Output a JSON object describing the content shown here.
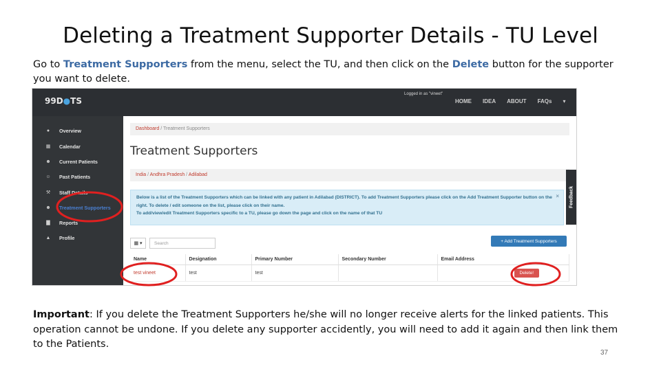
{
  "slide": {
    "title": "Deleting a Treatment Supporter Details - TU Level",
    "intro": {
      "part1": "Go to ",
      "link1": "Treatment Supporters",
      "part2": " from the menu, select the TU, and then click on the ",
      "link2": "Delete",
      "part3": " button for the supporter you want to delete."
    },
    "important_label": "Important",
    "important_text": ": If you delete the Treatment Supporters he/she will no longer receive alerts for the linked patients. This operation cannot be undone. If you delete any supporter accidently, you will need to add it again and then link them to the Patients.",
    "page_number": "37"
  },
  "app": {
    "logo_prefix": "99D",
    "logo_suffix": "TS",
    "logged_in": "Logged in as \"vineet\"",
    "topnav": [
      "HOME",
      "IDEA",
      "ABOUT",
      "FAQs",
      "▾"
    ],
    "sidebar": [
      {
        "label": "Overview",
        "icon": "●"
      },
      {
        "label": "Calendar",
        "icon": "▦"
      },
      {
        "label": "Current Patients",
        "icon": "☻"
      },
      {
        "label": "Past Patients",
        "icon": "☺"
      },
      {
        "label": "Staff Details",
        "icon": "⚒"
      },
      {
        "label": "Treatment Supporters",
        "icon": "☻"
      },
      {
        "label": "Reports",
        "icon": "▇"
      },
      {
        "label": "Profile",
        "icon": "▲"
      }
    ],
    "breadcrumb1": {
      "dashboard": "Dashboard",
      "sep": " / ",
      "current": "Treatment Supporters"
    },
    "page_heading": "Treatment Supporters",
    "breadcrumb2": {
      "l1": "India",
      "l2": "Andhra Pradesh",
      "l3": "Adilabad",
      "sep": " / "
    },
    "info_text": "Below is a list of the Treatment Supporters which can be linked with any patient in Adilabad (DISTRICT). To add Treatment Supporters please click on the Add Treatment Supporter button on the right. To delete / edit someone on the list, please click on their name.",
    "info_text2": "To add/view/edit Treatment Supporters specific to a TU, please go down the page and click on the name of that TU",
    "close_symbol": "×",
    "feedback_label": "Feedback",
    "toolbar_icon": "▦ ▾",
    "search_placeholder": "Search",
    "add_button": "+ Add Treatment Supporters",
    "table": {
      "headers": [
        "Name",
        "Designation",
        "Primary Number",
        "Secondary Number",
        "Email Address"
      ],
      "rows": [
        {
          "name": "test vineet",
          "designation": "test",
          "primary": "test",
          "secondary": "",
          "email": ""
        }
      ]
    },
    "delete_button": "Delete!"
  },
  "colors": {
    "accent_blue": "#3c6aa3",
    "annotation_red": "#e02020",
    "navbar": "#2c2f33",
    "info_bg": "#d9edf7"
  }
}
